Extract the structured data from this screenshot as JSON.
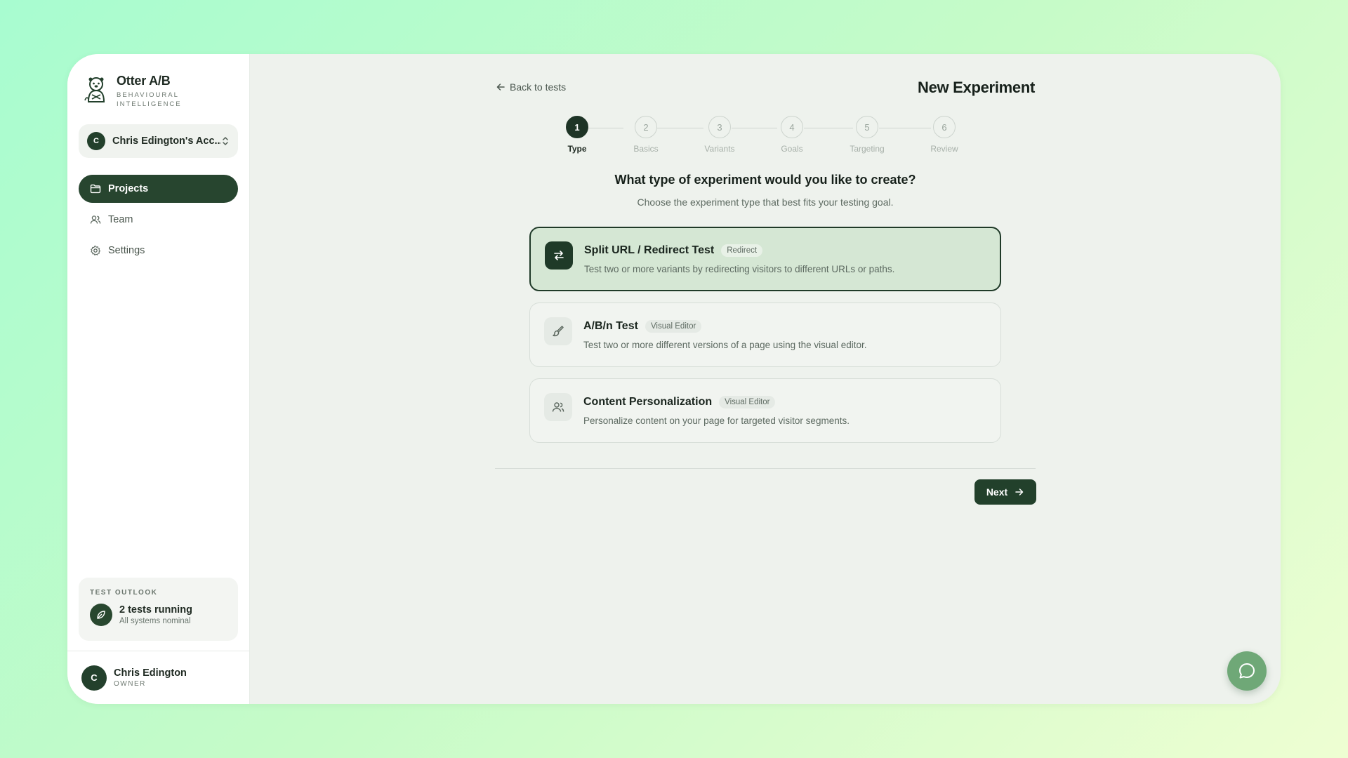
{
  "brand": {
    "name": "Otter A/B",
    "tagline_line1": "BEHAVIOURAL",
    "tagline_line2": "INTELLIGENCE"
  },
  "account": {
    "initial": "C",
    "name": "Chris Edington's Acc..."
  },
  "nav": {
    "projects": "Projects",
    "team": "Team",
    "settings": "Settings"
  },
  "outlook": {
    "title": "TEST OUTLOOK",
    "main": "2 tests running",
    "sub": "All systems nominal"
  },
  "user": {
    "initial": "C",
    "name": "Chris Edington",
    "role": "OWNER"
  },
  "header": {
    "back_label": "Back to tests",
    "title": "New Experiment"
  },
  "stepper": {
    "steps": [
      {
        "number": "1",
        "label": "Type"
      },
      {
        "number": "2",
        "label": "Basics"
      },
      {
        "number": "3",
        "label": "Variants"
      },
      {
        "number": "4",
        "label": "Goals"
      },
      {
        "number": "5",
        "label": "Targeting"
      },
      {
        "number": "6",
        "label": "Review"
      }
    ],
    "active_index": 0
  },
  "question": {
    "title": "What type of experiment would you like to create?",
    "subtitle": "Choose the experiment type that best fits your testing goal."
  },
  "options": [
    {
      "title": "Split URL / Redirect Test",
      "badge": "Redirect",
      "description": "Test two or more variants by redirecting visitors to different URLs or paths.",
      "icon": "arrows-swap-icon",
      "selected": true
    },
    {
      "title": "A/B/n Test",
      "badge": "Visual Editor",
      "description": "Test two or more different versions of a page using the visual editor.",
      "icon": "paintbrush-icon",
      "selected": false
    },
    {
      "title": "Content Personalization",
      "badge": "Visual Editor",
      "description": "Personalize content on your page for targeted visitor segments.",
      "icon": "users-icon",
      "selected": false
    }
  ],
  "footer": {
    "next_label": "Next"
  },
  "colors": {
    "primary": "#22402b",
    "selected_card_bg": "#d5e7d4",
    "chat_button": "#6fa877"
  }
}
